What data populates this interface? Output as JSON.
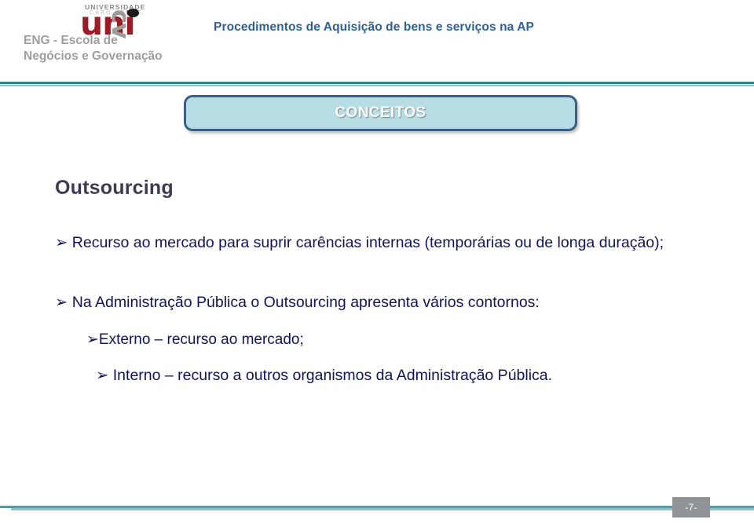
{
  "header": {
    "logo": {
      "top_word": "UNIVERSIDADE",
      "sub_word": "CABO VERDE",
      "wordmark": "uni",
      "wordmark_suffix": "cv",
      "school_name": "ENG - Escola de Negócios e Governação"
    },
    "title": "Procedimentos  de Aquisição de bens e serviços na AP",
    "title_color": "#2e6094"
  },
  "title_box": {
    "label": "CONCEITOS",
    "fill_color": "#b6dde4",
    "border_color": "#3c5f86",
    "text_color": "#ffffff"
  },
  "content": {
    "heading": "Outsourcing",
    "heading_color": "#3b3b55",
    "text_color": "#131356",
    "bullet_glyph": "➢",
    "bullets": [
      {
        "level": 1,
        "text": "Recurso ao mercado para suprir carências internas (temporárias ou de longa duração);"
      },
      {
        "level": 1,
        "text": "Na Administração Pública o Outsourcing apresenta vários contornos:"
      },
      {
        "level": 2,
        "text": "Externo – recurso ao mercado;"
      },
      {
        "level": 2,
        "text": "Interno – recurso a outros organismos da Administração Pública."
      }
    ]
  },
  "footer": {
    "page_number": "-7-",
    "rule_color": "#5e97a0",
    "page_box_color": "#909496"
  }
}
